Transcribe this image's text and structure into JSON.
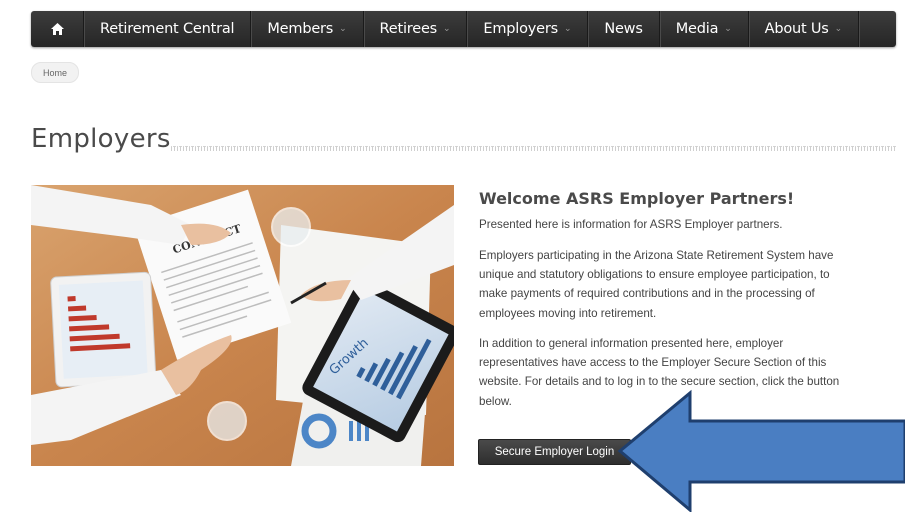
{
  "nav": {
    "home_icon": "home-icon",
    "items": [
      {
        "label": "Retirement Central",
        "has_dropdown": false
      },
      {
        "label": "Members",
        "has_dropdown": true
      },
      {
        "label": "Retirees",
        "has_dropdown": true
      },
      {
        "label": "Employers",
        "has_dropdown": true
      },
      {
        "label": "News",
        "has_dropdown": false
      },
      {
        "label": "Media",
        "has_dropdown": true
      },
      {
        "label": "About Us",
        "has_dropdown": true
      }
    ],
    "caret": "⌄"
  },
  "breadcrumb": {
    "home": "Home"
  },
  "page": {
    "title": "Employers"
  },
  "hero": {
    "contract_text": "CONTRACT",
    "tablet_text": "Growth"
  },
  "content": {
    "welcome_title": "Welcome ASRS Employer Partners!",
    "intro": "Presented here is information for ASRS Employer partners.",
    "para1": "Employers participating in the Arizona State Retirement System have unique and statutory obligations to ensure employee participation, to make payments of required contributions and in the processing of employees moving into retirement.",
    "para2": "In addition to general information presented here, employer representatives have access to the Employer Secure Section of this website. For details and to log in to the secure section, click the button below.",
    "login_button": "Secure Employer Login"
  },
  "colors": {
    "nav_bg": "#2e2e2e",
    "button_bg": "#3a3a3a",
    "arrow_fill": "#4a7ec2",
    "arrow_stroke": "#1f3f6e"
  }
}
